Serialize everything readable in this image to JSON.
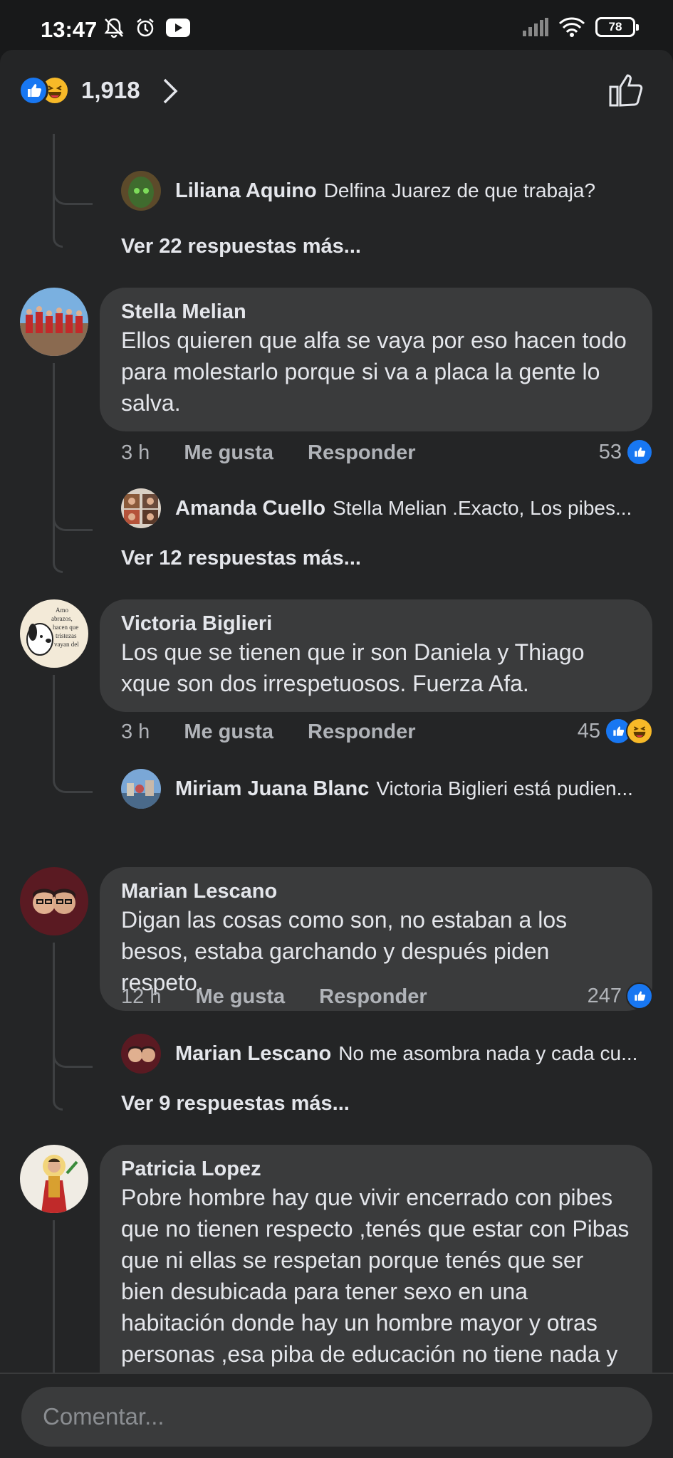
{
  "status_bar": {
    "time": "13:47",
    "battery": "78"
  },
  "reactions": {
    "count": "1,918",
    "icons": [
      "like-icon",
      "haha-icon"
    ]
  },
  "thread_top": {
    "reply": {
      "author": "Liliana Aquino",
      "text": "Delfina Juarez de que trabaja?"
    },
    "more": "Ver 22 respuestas más..."
  },
  "comments": [
    {
      "author": "Stella Melian",
      "text": "Ellos quieren que alfa se vaya por eso hacen todo para molestarlo porque si va a placa la gente lo salva.",
      "time": "3 h",
      "like_label": "Me gusta",
      "reply_label": "Responder",
      "reactions": "53",
      "reply": {
        "author": "Amanda Cuello",
        "text": "Stella Melian .Exacto, Los pibes..."
      },
      "more": "Ver 12 respuestas más..."
    },
    {
      "author": "Victoria Biglieri",
      "text": "Los que se tienen que ir son Daniela y Thiago xque son dos irrespetuosos. Fuerza Afa.",
      "time": "3 h",
      "like_label": "Me gusta",
      "reply_label": "Responder",
      "reactions": "45",
      "reply": {
        "author": "Miriam Juana Blanc",
        "text": "Victoria Biglieri está pudien..."
      }
    },
    {
      "author": "Marian Lescano",
      "text": "Digan las cosas como son, no estaban a los besos, estaba garchando y después piden respeto.",
      "time": "12 h",
      "like_label": "Me gusta",
      "reply_label": "Responder",
      "reactions": "247",
      "reply": {
        "author": "Marian Lescano",
        "text": "No me asombra nada y cada cu..."
      },
      "more": "Ver 9 respuestas más..."
    },
    {
      "author": "Patricia Lopez",
      "text": "Pobre hombre hay que vivir encerrado con pibes que no tienen respecto ,tenés que estar con Pibas que ni ellas se respetan porque tenés que ser bien desubicada para tener sexo en una habitación donde hay un hombre mayor y otras personas ,esa piba de educación no tiene nada y después quiere respecto, yo fuera alfa me voy no podría vivir"
    }
  ],
  "avatar_1_text": "Amo abrazos, hacen que las tristezas vayan del cuer",
  "comment_box": {
    "placeholder": "Comentar..."
  },
  "colors": {
    "background": "#242526",
    "bubble": "#3a3b3c",
    "like_blue": "#1877f2",
    "haha_yellow": "#f7b928",
    "muted_text": "#b0b3b8"
  }
}
